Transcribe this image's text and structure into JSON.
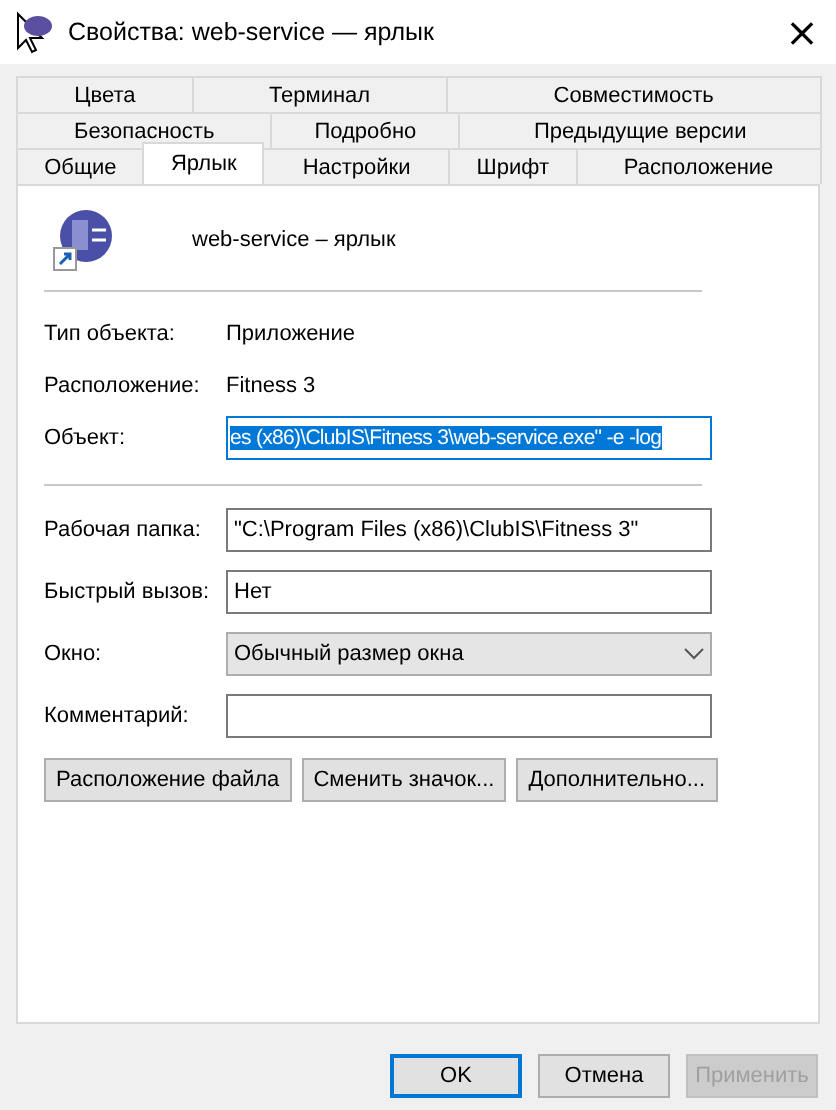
{
  "window": {
    "title": "Свойства: web-service — ярлык",
    "close": "×"
  },
  "tab_rows": [
    {
      "tabs": [
        {
          "label": "Цвета",
          "selected": false
        },
        {
          "label": "Терминал",
          "selected": false
        },
        {
          "label": "Совместимость",
          "selected": false
        }
      ]
    },
    {
      "tabs": [
        {
          "label": "Безопасность",
          "selected": false
        },
        {
          "label": "Подробно",
          "selected": false
        },
        {
          "label": "Предыдущие версии",
          "selected": false
        }
      ]
    },
    {
      "tabs": [
        {
          "label": "Общие",
          "selected": false
        },
        {
          "label": "Ярлык",
          "selected": true
        },
        {
          "label": "Настройки",
          "selected": false
        },
        {
          "label": "Шрифт",
          "selected": false
        },
        {
          "label": "Расположение",
          "selected": false
        }
      ]
    }
  ],
  "shortcut_name": "web-service – ярлык",
  "info_rows": [
    {
      "label": "Тип объекта:",
      "value": "Приложение"
    },
    {
      "label": "Расположение:",
      "value": "Fitness 3"
    }
  ],
  "target": {
    "label": "Объект:",
    "value": "es (x86)\\ClubIS\\Fitness 3\\web-service.exe\" -e -log",
    "text_selected": true
  },
  "fields": [
    {
      "kind": "input",
      "label": "Рабочая папка:",
      "value": "\"C:\\Program Files (x86)\\ClubIS\\Fitness 3\""
    },
    {
      "kind": "input",
      "label": "Быстрый вызов:",
      "value": "Нет"
    },
    {
      "kind": "dropdown",
      "label": "Окно:",
      "value": "Обычный размер окна"
    },
    {
      "kind": "input",
      "label": "Комментарий:"
    }
  ],
  "actions": [
    "Расположение файла",
    "Сменить значок...",
    "Дополнительно..."
  ],
  "buttons": [
    {
      "label": "OK",
      "default": true,
      "disabled": false
    },
    {
      "label": "Отмена",
      "default": false,
      "disabled": false
    },
    {
      "label": "Применить",
      "default": false,
      "disabled": true
    }
  ]
}
